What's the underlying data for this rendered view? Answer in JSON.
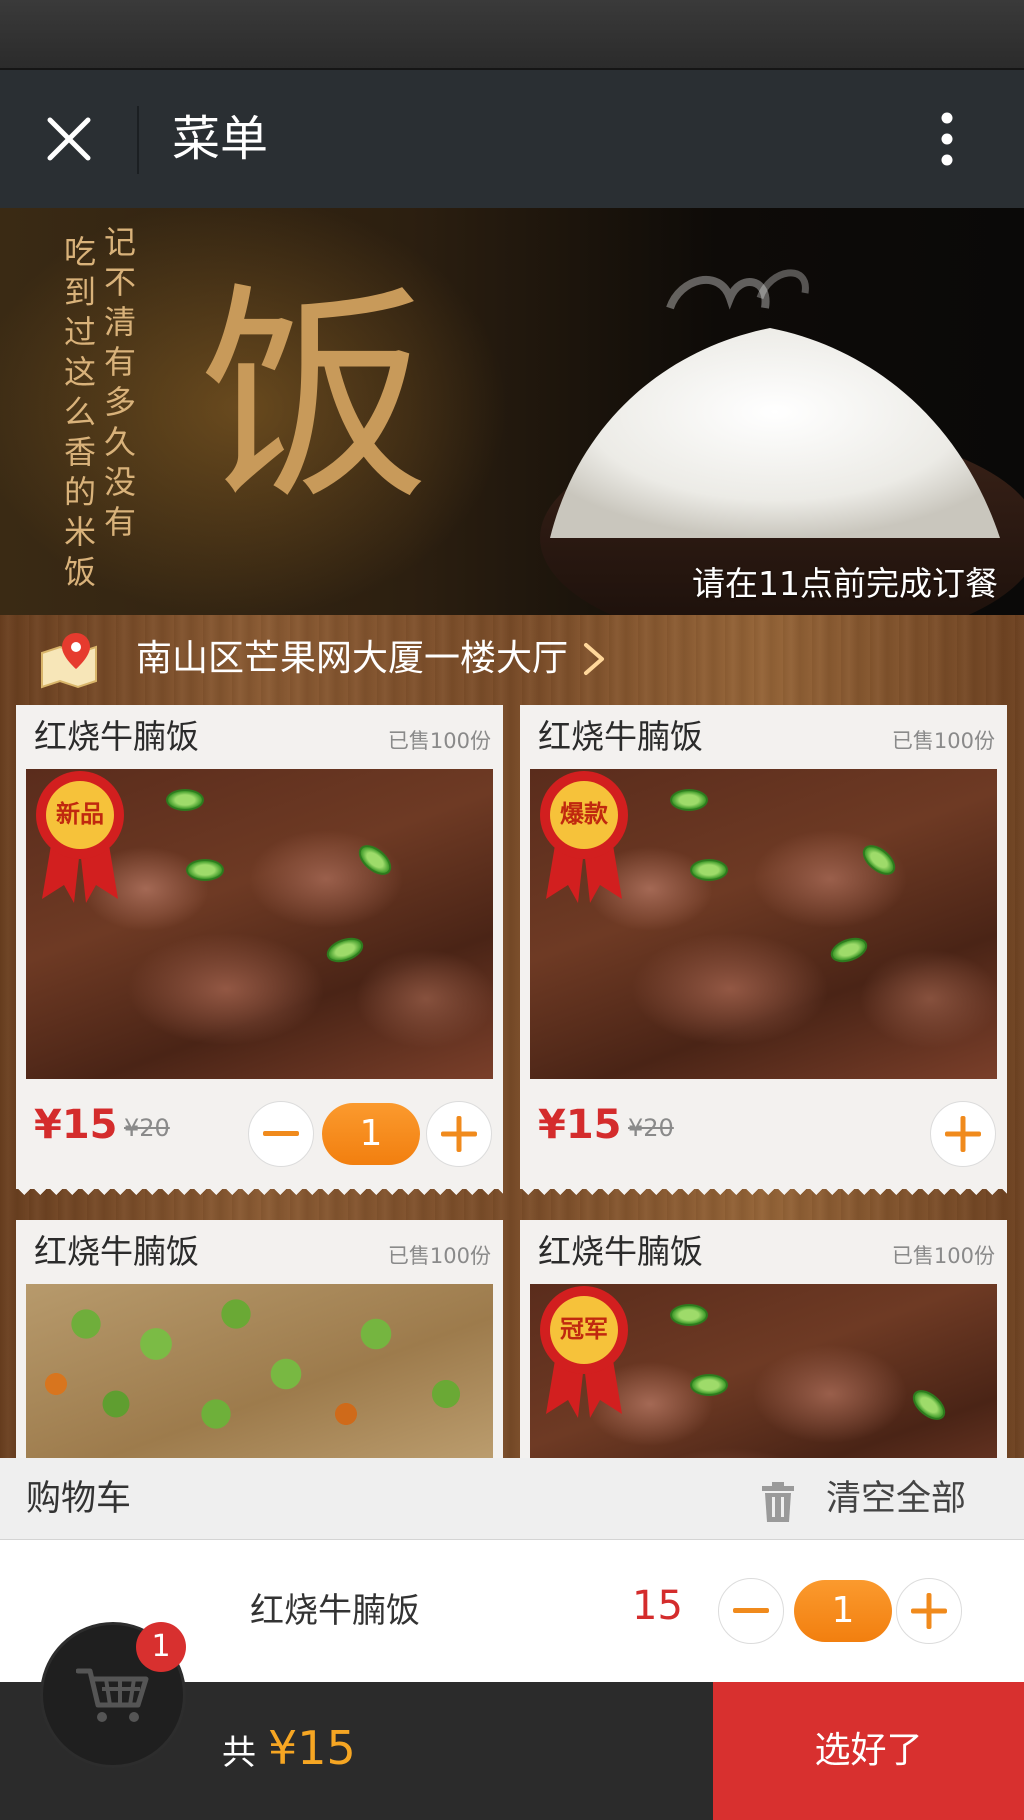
{
  "nav": {
    "title": "菜单",
    "close_icon": "close-icon",
    "more_icon": "more-vertical-icon"
  },
  "banner": {
    "poem_col1": "记不清有多久没有",
    "poem_col2": "吃到过这么香的米饭",
    "big_char": "饭",
    "notice": "请在11点前完成订餐"
  },
  "location": {
    "text": "南山区芒果网大厦一楼大厅",
    "icon": "map-pin-icon"
  },
  "cards": [
    {
      "title": "红烧牛腩饭",
      "sold": "已售100份",
      "badge": "新品",
      "price": "¥15",
      "old_price": "¥20",
      "quantity": "1",
      "image": "braised-beef"
    },
    {
      "title": "红烧牛腩饭",
      "sold": "已售100份",
      "badge": "爆款",
      "price": "¥15",
      "old_price": "¥20",
      "quantity": "0",
      "image": "braised-beef"
    },
    {
      "title": "红烧牛腩饭",
      "sold": "已售100份",
      "badge": "",
      "price": "",
      "old_price": "",
      "quantity": "",
      "image": "peas-dish"
    },
    {
      "title": "红烧牛腩饭",
      "sold": "已售100份",
      "badge": "冠军",
      "price": "",
      "old_price": "",
      "quantity": "",
      "image": "braised-beef"
    }
  ],
  "cart": {
    "title": "购物车",
    "clear_label": "清空全部",
    "items": [
      {
        "name": "红烧牛腩饭",
        "price": "15",
        "quantity": "1"
      }
    ],
    "badge_count": "1",
    "total_label": "共",
    "total_value": "¥15",
    "checkout_label": "选好了"
  },
  "colors": {
    "accent_orange": "#f27f0f",
    "price_red": "#d42c2c",
    "checkout_red": "#d8302f",
    "total_yellow": "#f6a623"
  }
}
